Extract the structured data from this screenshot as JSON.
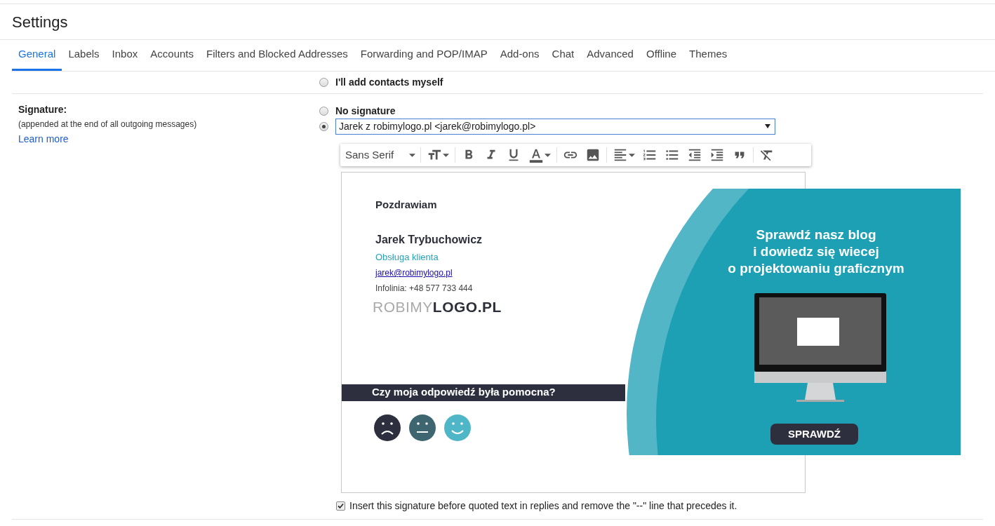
{
  "page_title": "Settings",
  "tabs": [
    {
      "label": "General",
      "selected": true
    },
    {
      "label": "Labels",
      "selected": false
    },
    {
      "label": "Inbox",
      "selected": false
    },
    {
      "label": "Accounts",
      "selected": false
    },
    {
      "label": "Filters and Blocked Addresses",
      "selected": false
    },
    {
      "label": "Forwarding and POP/IMAP",
      "selected": false
    },
    {
      "label": "Add-ons",
      "selected": false
    },
    {
      "label": "Chat",
      "selected": false
    },
    {
      "label": "Advanced",
      "selected": false
    },
    {
      "label": "Offline",
      "selected": false
    },
    {
      "label": "Themes",
      "selected": false
    }
  ],
  "contacts_option": {
    "label": "I'll add contacts myself",
    "selected": false
  },
  "signature": {
    "label": "Signature:",
    "hint": "(appended at the end of all outgoing messages)",
    "learn_more": "Learn more",
    "options": [
      {
        "kind": "none",
        "label": "No signature",
        "selected": false
      },
      {
        "kind": "select",
        "value": "Jarek z robimylogo.pl <jarek@robimylogo.pl>",
        "selected": true
      }
    ],
    "toolbar": {
      "font": "Sans Serif"
    },
    "editor": {
      "greeting": "Pozdrawiam",
      "name": "Jarek Trybuchowicz",
      "role": "Obsługa klienta",
      "email": "jarek@robimylogo.pl",
      "phone": "Infolinia: +48 577 733 444",
      "logo_light": "ROBIMY",
      "logo_bold": "LOGO.PL",
      "feedback": "Czy moja odpowiedź była pomocna?",
      "banner": {
        "heading_lines": [
          "Sprawdź nasz blog",
          "i dowiedz się wiecej",
          "o projektowaniu graficznym"
        ],
        "button": "SPRAWDŹ"
      }
    },
    "insert_before_quote": {
      "label": "Insert this signature before quoted text in replies and remove the \"--\" line that precedes it.",
      "checked": true
    }
  }
}
